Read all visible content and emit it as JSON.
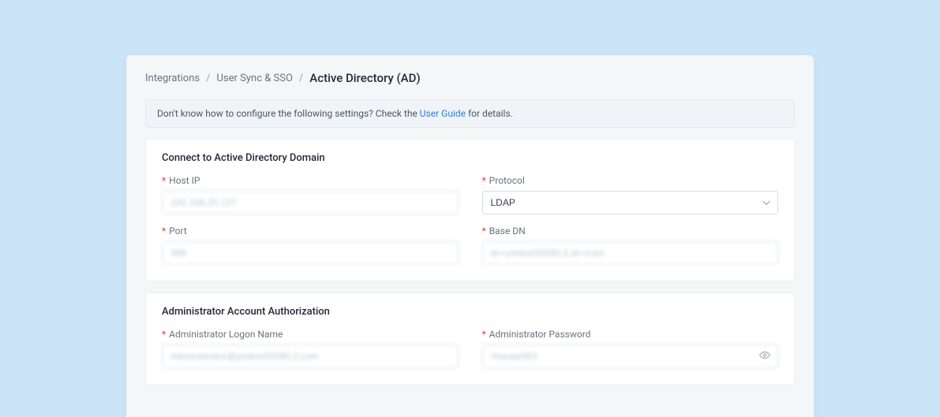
{
  "breadcrumb": {
    "item1": "Integrations",
    "item2": "User Sync & SSO",
    "current": "Active Directory (AD)"
  },
  "banner": {
    "prefix": "Don't know how to configure the following settings? Check the ",
    "link": "User Guide",
    "suffix": " for details."
  },
  "section1": {
    "title": "Connect to Active Directory Domain",
    "host_ip": {
      "label": "Host IP",
      "value": "192.168.20.127"
    },
    "protocol": {
      "label": "Protocol",
      "value": "LDAP"
    },
    "port": {
      "label": "Port",
      "value": "389"
    },
    "base_dn": {
      "label": "Base DN",
      "value": "dc=ymtest20080.2,dc=com"
    }
  },
  "section2": {
    "title": "Administrator Account Authorization",
    "admin_name": {
      "label": "Administrator Logon Name",
      "value": "Administrator@ymtest20080.2.com"
    },
    "admin_password": {
      "label": "Administrator Password",
      "value": "Yeastar001"
    }
  }
}
